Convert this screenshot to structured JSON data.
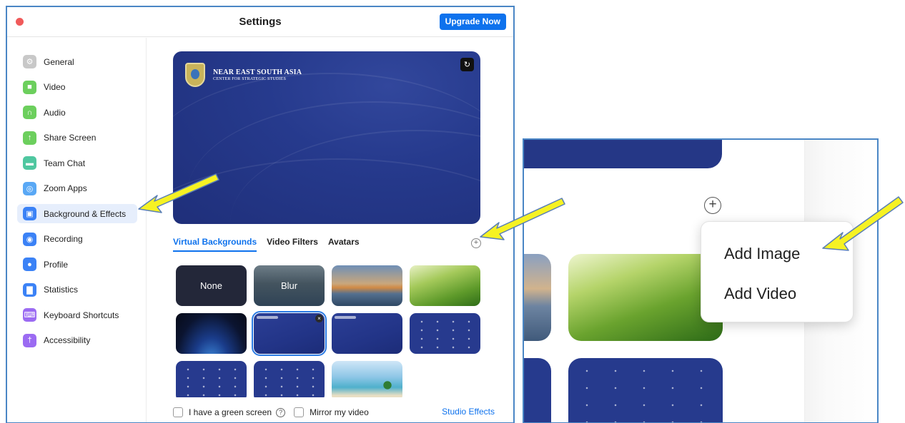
{
  "window": {
    "title": "Settings",
    "upgrade_label": "Upgrade Now"
  },
  "sidebar": {
    "items": [
      {
        "label": "General",
        "icon": "gear-icon",
        "color": "#c8c8c8"
      },
      {
        "label": "Video",
        "icon": "video-icon",
        "color": "#6ccf5d"
      },
      {
        "label": "Audio",
        "icon": "headphones-icon",
        "color": "#6ccf5d"
      },
      {
        "label": "Share Screen",
        "icon": "share-screen-icon",
        "color": "#6ccf5d"
      },
      {
        "label": "Team Chat",
        "icon": "chat-icon",
        "color": "#4fc7a0"
      },
      {
        "label": "Zoom Apps",
        "icon": "apps-icon",
        "color": "#59a8f5"
      },
      {
        "label": "Background & Effects",
        "icon": "background-icon",
        "color": "#3b82f6"
      },
      {
        "label": "Recording",
        "icon": "recording-icon",
        "color": "#3b82f6"
      },
      {
        "label": "Profile",
        "icon": "profile-icon",
        "color": "#3b82f6"
      },
      {
        "label": "Statistics",
        "icon": "statistics-icon",
        "color": "#3b82f6"
      },
      {
        "label": "Keyboard Shortcuts",
        "icon": "keyboard-icon",
        "color": "#9b6bf2"
      },
      {
        "label": "Accessibility",
        "icon": "accessibility-icon",
        "color": "#9b6bf2"
      }
    ],
    "active_index": 6
  },
  "preview": {
    "logo_line1": "NEAR EAST SOUTH ASIA",
    "logo_line2": "CENTER FOR STRATEGIC STUDIES"
  },
  "tabs": [
    "Virtual Backgrounds",
    "Video Filters",
    "Avatars"
  ],
  "active_tab": 0,
  "backgrounds": [
    {
      "label": "None",
      "kind": "none"
    },
    {
      "label": "Blur",
      "kind": "blur"
    },
    {
      "label": "",
      "kind": "bridge"
    },
    {
      "label": "",
      "kind": "grass"
    },
    {
      "label": "",
      "kind": "earth"
    },
    {
      "label": "",
      "kind": "neso",
      "selected": true
    },
    {
      "label": "",
      "kind": "neso"
    },
    {
      "label": "",
      "kind": "neso-pattern"
    },
    {
      "label": "",
      "kind": "neso-pattern"
    },
    {
      "label": "",
      "kind": "neso-pattern"
    },
    {
      "label": "",
      "kind": "beach"
    }
  ],
  "footer": {
    "green_screen_label": "I have a green screen",
    "mirror_label": "Mirror my video",
    "studio_effects_label": "Studio Effects"
  },
  "add_menu": {
    "items": [
      "Add Image",
      "Add Video"
    ]
  },
  "colors": {
    "accent": "#0e72ed",
    "highlight_arrow": "#f6f223",
    "frame_border": "#4a86c5"
  }
}
